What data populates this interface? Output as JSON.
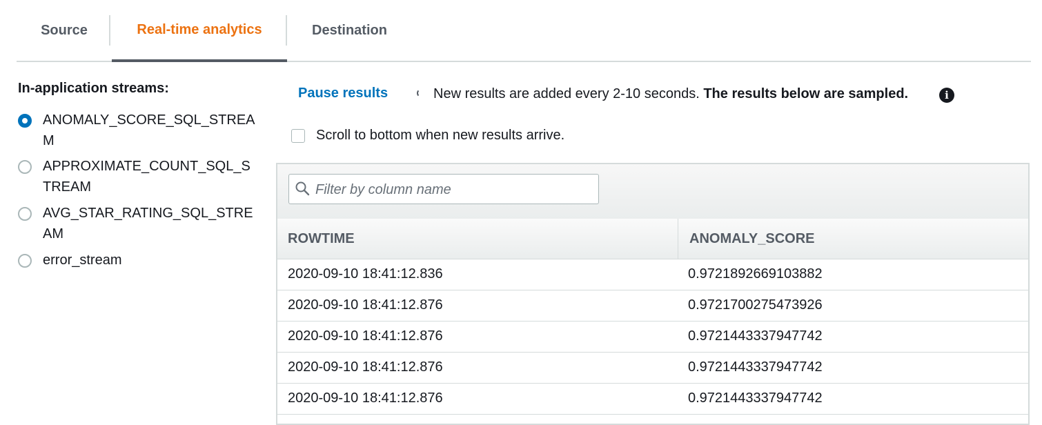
{
  "tabs": [
    {
      "label": "Source"
    },
    {
      "label": "Real-time analytics",
      "active": true
    },
    {
      "label": "Destination"
    }
  ],
  "streams": {
    "title": "In-application streams:",
    "items": [
      {
        "label": "ANOMALY_SCORE_SQL_STREAM",
        "selected": true
      },
      {
        "label": "APPROXIMATE_COUNT_SQL_STREAM",
        "selected": false
      },
      {
        "label": "AVG_STAR_RATING_SQL_STREAM",
        "selected": false
      },
      {
        "label": "error_stream",
        "selected": false
      }
    ]
  },
  "controls": {
    "pause_label": "Pause results",
    "info_text": "New results are added every 2-10 seconds.",
    "info_bold": "The results below are sampled.",
    "scroll_label": "Scroll to bottom when new results arrive."
  },
  "table": {
    "filter_placeholder": "Filter by column name",
    "columns": [
      "ROWTIME",
      "ANOMALY_SCORE"
    ],
    "rows": [
      [
        "2020-09-10 18:41:12.836",
        "0.9721892669103882"
      ],
      [
        "2020-09-10 18:41:12.876",
        "0.9721700275473926"
      ],
      [
        "2020-09-10 18:41:12.876",
        "0.9721443337947742"
      ],
      [
        "2020-09-10 18:41:12.876",
        "0.9721443337947742"
      ],
      [
        "2020-09-10 18:41:12.876",
        "0.9721443337947742"
      ]
    ]
  },
  "colors": {
    "accent": "#ec7211",
    "link": "#0073bb",
    "radio_selected": "#0073bb"
  }
}
